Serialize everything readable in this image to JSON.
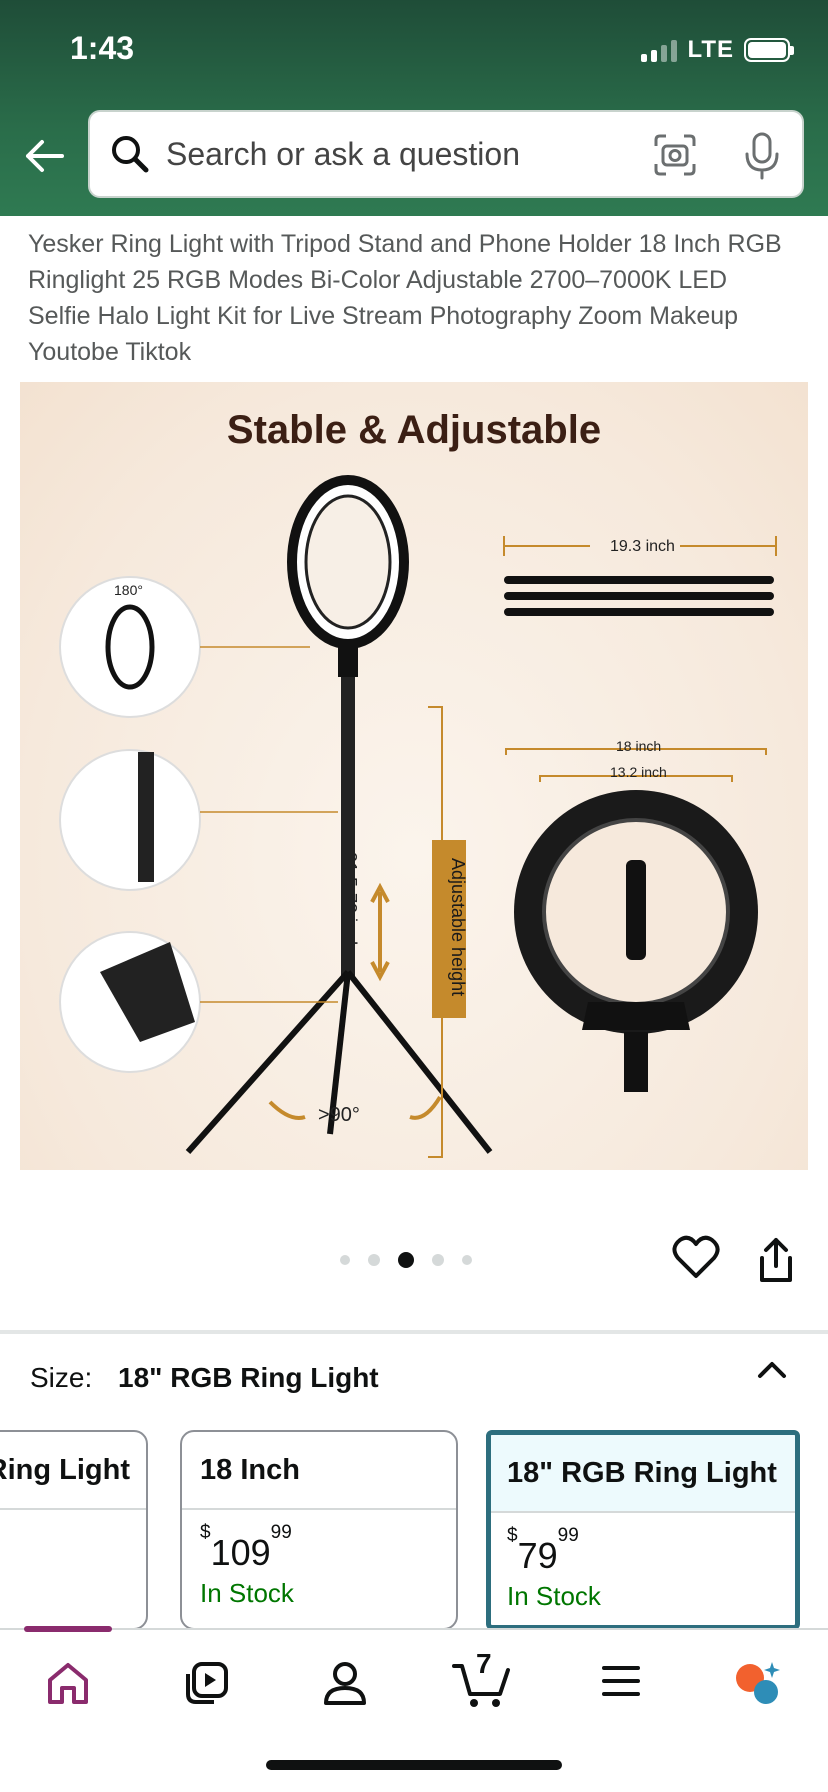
{
  "status_bar": {
    "time": "1:43",
    "network": "LTE"
  },
  "search": {
    "placeholder": "Search or ask a question"
  },
  "product": {
    "title": "Yesker Ring Light with Tripod Stand and Phone Holder 18 Inch RGB Ringlight 25 RGB Modes Bi-Color Adjustable 2700–7000K LED Selfie Halo Light Kit for Live Stream Photography Zoom Makeup Youtobe Tiktok"
  },
  "image": {
    "headline": "Stable & Adjustable",
    "rotation_label": "180°",
    "folded_length": "19.3 inch",
    "outer_diameter": "18 inch",
    "inner_diameter": "13.2 inch",
    "height_range": "31.5-73 inch",
    "height_caption": "Adjustable height",
    "leg_angle": ">90°"
  },
  "carousel": {
    "total": 5,
    "active_index": 2
  },
  "size": {
    "label": "Size:",
    "selected": "18\" RGB Ring Light"
  },
  "size_options": [
    {
      "name": "Ring Light",
      "price_whole": "",
      "price_cents": "",
      "stock": "",
      "selected": false
    },
    {
      "name": "18 Inch",
      "price_whole": "109",
      "price_cents": "99",
      "stock": "In Stock",
      "selected": false
    },
    {
      "name": "18\" RGB Ring Light",
      "price_whole": "79",
      "price_cents": "99",
      "stock": "In Stock",
      "selected": true
    }
  ],
  "currency_symbol": "$",
  "bottom_nav": {
    "items": [
      "home-icon",
      "video-icon",
      "account-icon",
      "cart-icon",
      "menu-icon",
      "rufus-icon"
    ],
    "cart_count": "7"
  },
  "colors": {
    "header_green": "#2a6d4a",
    "selected_border": "#2d6e7e",
    "in_stock": "#007600",
    "nav_accent": "#8a2b6d"
  }
}
